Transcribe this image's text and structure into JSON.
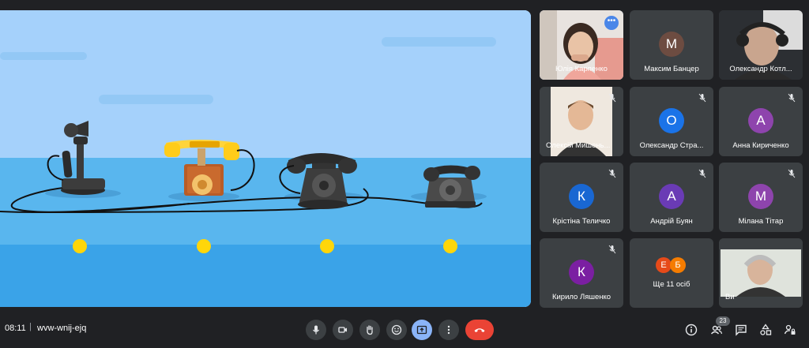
{
  "presentation": {
    "name": "telephone-evolution-slide",
    "phones": [
      "candlestick-telephone-icon",
      "ornate-telephone-icon",
      "rotary-telephone-icon",
      "modern-rotary-telephone-icon"
    ],
    "dots": 4,
    "colors": {
      "sky": "#a5d1fb",
      "table": "#59b6ee",
      "dot": "#ffd60a"
    }
  },
  "participants": [
    {
      "name": "Юлія Карпенко",
      "type": "video",
      "active": true,
      "menu": "•••"
    },
    {
      "name": "Максим Банцер",
      "initial": "М",
      "color": "#6d4c41"
    },
    {
      "name": "Олександр Котл...",
      "type": "video"
    },
    {
      "name": "Олексій Мишень...",
      "type": "video",
      "muted": true
    },
    {
      "name": "Олександр Стра...",
      "initial": "О",
      "color": "#1a73e8",
      "muted": true
    },
    {
      "name": "Анна Кириченко",
      "initial": "А",
      "color": "#8e44ad",
      "muted": true
    },
    {
      "name": "Крістіна Теличко",
      "initial": "К",
      "color": "#1967d2",
      "muted": true
    },
    {
      "name": "Андрій Буян",
      "initial": "А",
      "color": "#6a3bb5",
      "muted": true
    },
    {
      "name": "Мілана Тітар",
      "initial": "М",
      "color": "#8e44ad",
      "muted": true
    },
    {
      "name": "Кирило Ляшенко",
      "initial": "К",
      "color": "#7b1fa2",
      "muted": true
    },
    {
      "name": "Ще 11 осіб",
      "others": [
        "Е",
        "Б"
      ],
      "colors": [
        "#e64a19",
        "#f57c00"
      ]
    },
    {
      "name": "Ви",
      "type": "video"
    }
  ],
  "bottom_bar": {
    "time": "08:11",
    "separator": "|",
    "meeting_code": "wvw-wnij-ejq",
    "people_count": "23",
    "accent_color": "#8ab4f8",
    "end_color": "#ea4335"
  }
}
